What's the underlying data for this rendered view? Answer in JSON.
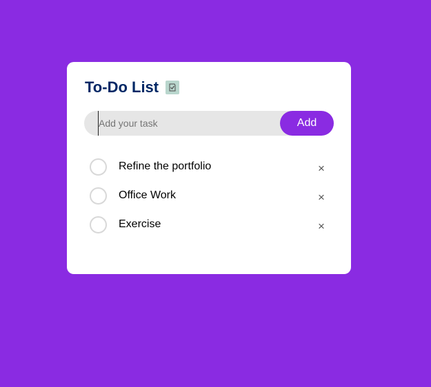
{
  "app": {
    "title": "To-Do List",
    "title_icon": "checklist-icon"
  },
  "input": {
    "placeholder": "Add your task",
    "value": ""
  },
  "add_button": {
    "label": "Add"
  },
  "tasks": [
    {
      "text": "Refine the portfolio",
      "checked": false,
      "delete_label": "×"
    },
    {
      "text": "Office Work",
      "checked": false,
      "delete_label": "×"
    },
    {
      "text": "Exercise",
      "checked": false,
      "delete_label": "×"
    }
  ],
  "colors": {
    "background": "#8a2be2",
    "card": "#ffffff",
    "title": "#002765",
    "input_bg": "#e6e6e6",
    "accent": "#8a2be2"
  }
}
